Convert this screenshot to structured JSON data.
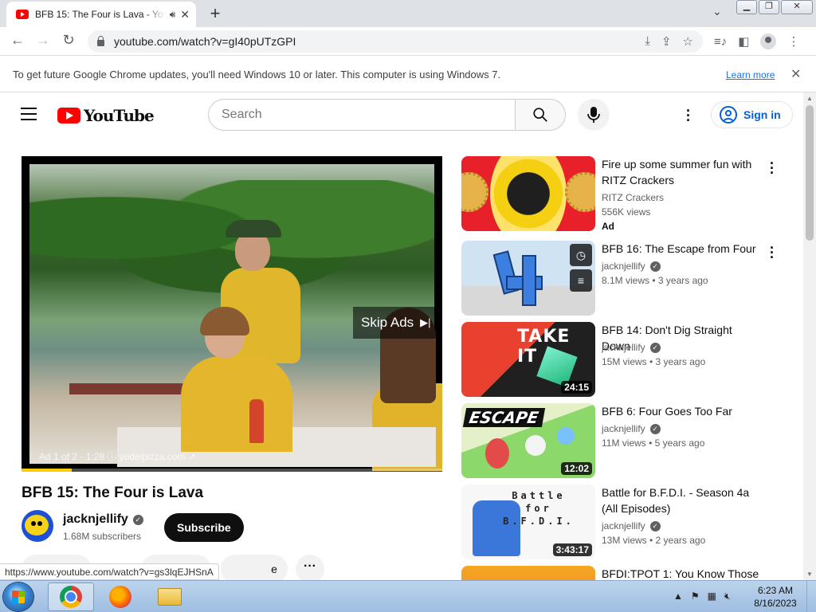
{
  "browser": {
    "tab_title": "BFB 15: The Four is Lava - YouTube",
    "new_tab_symbol": "+",
    "url": "youtube.com/watch?v=gI40pUTzGPI",
    "status_url": "https://www.youtube.com/watch?v=gs3lqEJHSnA"
  },
  "infobar": {
    "message": "To get future Google Chrome updates, you'll need Windows 10 or later. This computer is using Windows 7.",
    "learn_more": "Learn more"
  },
  "masthead": {
    "logo_text": "YouTube",
    "search_placeholder": "Search",
    "sign_in": "Sign in"
  },
  "player": {
    "skip_label": "Skip Ads",
    "ad_info": "Ad 1 of 2 · 1:28 ⓘ  yodelpizza.com ↗",
    "ad_progress_fraction": 0.12
  },
  "video": {
    "title": "BFB 15: The Four is Lava",
    "channel": "jacknjellify",
    "subscribers": "1.68M subscribers",
    "subscribe_label": "Subscribe",
    "more_label": "···",
    "partial_action_text": "e"
  },
  "related": [
    {
      "title": "Fire up some summer fun with RITZ Crackers",
      "channel": "RITZ Crackers",
      "meta": "556K views",
      "badge": "Ad",
      "duration": "",
      "verified": false
    },
    {
      "title": "BFB 16: The Escape from Four",
      "channel": "jacknjellify",
      "meta": "8.1M views  • 3 years ago",
      "duration": "",
      "verified": true
    },
    {
      "title": "BFB 14: Don't Dig Straight Down",
      "channel": "jacknjellify",
      "meta": "15M views  • 3 years ago",
      "duration": "24:15",
      "verified": true,
      "thumb_text": "TAKE IT"
    },
    {
      "title": "BFB 6: Four Goes Too Far",
      "channel": "jacknjellify",
      "meta": "11M views  • 5 years ago",
      "duration": "12:02",
      "verified": true,
      "thumb_text": "ESCAPE"
    },
    {
      "title": "Battle for B.F.D.I. - Season 4a (All Episodes)",
      "channel": "jacknjellify",
      "meta": "13M views  • 2 years ago",
      "duration": "3:43:17",
      "verified": true,
      "thumb_text": "Battle for B.F.D.I."
    },
    {
      "title": "BFDI:TPOT 1: You Know Those",
      "channel": "",
      "meta": "",
      "duration": "",
      "verified": false
    }
  ],
  "taskbar": {
    "time": "6:23 AM",
    "date": "8/16/2023"
  },
  "colors": {
    "youtube_red": "#ff0000",
    "link_blue": "#065fd4",
    "ad_progress": "#ffcc00"
  }
}
